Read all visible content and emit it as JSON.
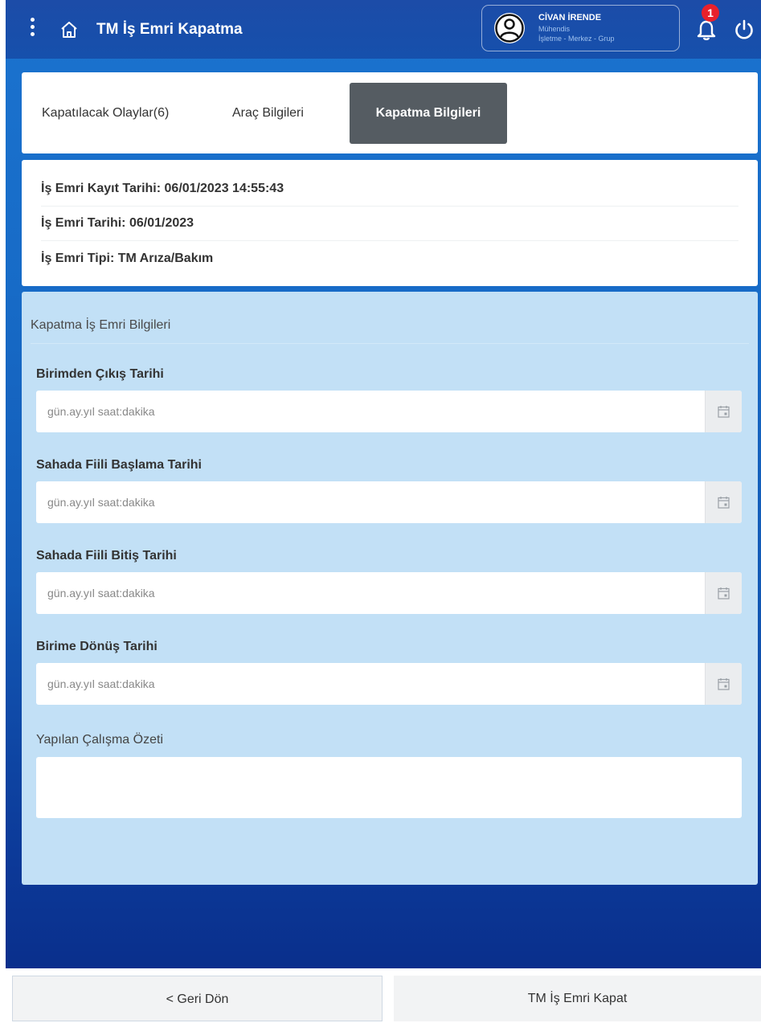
{
  "header": {
    "title": "TM İş Emri Kapatma",
    "user": {
      "name": "CİVAN İRENDE",
      "role": "Mühendis",
      "org": "İşletme - Merkez - Grup"
    },
    "notification_count": "1"
  },
  "tabs": [
    {
      "label": "Kapatılacak Olaylar(6)",
      "active": false
    },
    {
      "label": "Araç Bilgileri",
      "active": false
    },
    {
      "label": "Kapatma Bilgileri",
      "active": true
    }
  ],
  "info": {
    "kayit_tarihi": "İş Emri Kayıt Tarihi: 06/01/2023 14:55:43",
    "tarih": "İş Emri Tarihi: 06/01/2023",
    "tip": "İş Emri Tipi: TM Arıza/Bakım"
  },
  "form": {
    "section_title": "Kapatma İş Emri Bilgileri",
    "fields": [
      {
        "label": "Birimden Çıkış Tarihi",
        "placeholder": "gün.ay.yıl saat:dakika",
        "value": ""
      },
      {
        "label": "Sahada Fiili Başlama Tarihi",
        "placeholder": "gün.ay.yıl saat:dakika",
        "value": ""
      },
      {
        "label": "Sahada Fiili Bitiş Tarihi",
        "placeholder": "gün.ay.yıl saat:dakika",
        "value": ""
      },
      {
        "label": "Birime Dönüş Tarihi",
        "placeholder": "gün.ay.yıl saat:dakika",
        "value": ""
      }
    ],
    "summary_label": "Yapılan Çalışma Özeti",
    "summary_value": ""
  },
  "footer": {
    "back_label": "< Geri Dön",
    "submit_label": "TM İş Emri Kapat"
  },
  "colors": {
    "header_bg": "#1650ac",
    "active_tab_bg": "#555c62",
    "form_bg": "#c2e0f6",
    "badge": "#e8212b"
  },
  "icons": [
    "menu-icon",
    "home-icon",
    "user-avatar-icon",
    "bell-icon",
    "power-icon",
    "calendar-icon"
  ]
}
